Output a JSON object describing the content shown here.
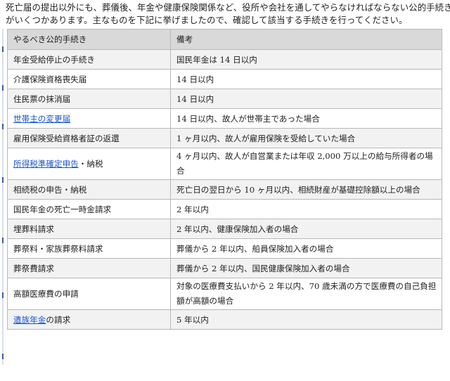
{
  "intro": {
    "line1": "死亡届の提出以外にも、葬儀後、年金や健康保険関係など、役所や会社を通してやらなければならない公的手続き",
    "line2": "がいくつかあります。主なものを下記に挙げましたので、確認して該当する手続きを行ってください。"
  },
  "table": {
    "headers": [
      "やるべき公的手続き",
      "備考"
    ],
    "rows": [
      {
        "proc": "年金受給停止の手続き",
        "note": "国民年金は 14 日以内"
      },
      {
        "proc": "介護保険資格喪失届",
        "note": "14 日以内"
      },
      {
        "proc": "住民票の抹消届",
        "note": "14 日以内"
      },
      {
        "proc_link": "世帯主の変更届",
        "note": "14 日以内、故人が世帯主であった場合"
      },
      {
        "proc": "雇用保険受給資格者証の返還",
        "note": "1 ヶ月以内、故人が雇用保険を受給していた場合"
      },
      {
        "proc_link": "所得税準確定申告",
        "proc_suffix": "・納税",
        "note": "4 ヶ月以内、故人が自営業または年収 2,000 万以上の給与所得者の場合"
      },
      {
        "proc": "相続税の申告・納税",
        "note": "死亡日の翌日から 10 ヶ月以内、相続財産が基礎控除額以上の場合"
      },
      {
        "proc": "国民年金の死亡一時金請求",
        "note": "2 年以内"
      },
      {
        "proc": "埋葬料請求",
        "note": "2 年以内、健康保険加入者の場合"
      },
      {
        "proc": "葬祭料・家族葬祭料請求",
        "note": "葬儀から 2 年以内、船員保険加入者の場合"
      },
      {
        "proc": "葬祭費請求",
        "note": "葬儀から 2 年以内、国民健康保険加入者の場合"
      },
      {
        "proc": "高額医療費の申請",
        "note": "対象の医療費支払いから 2 年以内、70 歳未満の方で医療費の自己負担額が高額の場合"
      },
      {
        "proc_link": "遺族年金",
        "proc_suffix": "の請求",
        "note": "5 年以内"
      }
    ]
  },
  "colors": {
    "link": "#1a56c9",
    "header_bg": "#d9d9d9",
    "row_alt_bg": "#f2f2f2",
    "border": "#b8b8b8",
    "left_marker": "#3d5fa0"
  }
}
